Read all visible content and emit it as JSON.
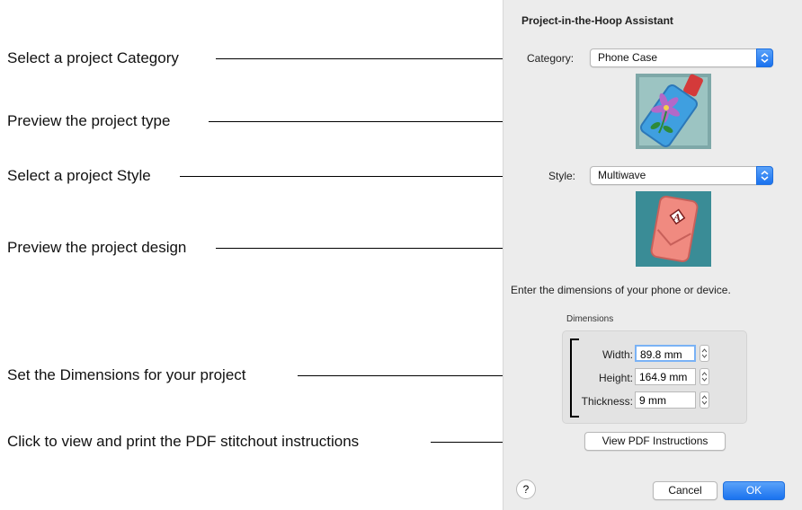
{
  "callouts": [
    "Select a project Category",
    "Preview the project type",
    "Select a project Style",
    "Preview the project design",
    "Set the Dimensions for your project",
    "Click to view and print the PDF stitchout instructions"
  ],
  "dialog": {
    "title": "Project-in-the-Hoop Assistant",
    "category_label": "Category:",
    "category_value": "Phone Case",
    "style_label": "Style:",
    "style_value": "Multiwave",
    "instruction": "Enter the dimensions of your phone or device.",
    "dimensions": {
      "group_label": "Dimensions",
      "width_label": "Width:",
      "width_value": "89.8 mm",
      "height_label": "Height:",
      "height_value": "164.9 mm",
      "thickness_label": "Thickness:",
      "thickness_value": "9 mm"
    },
    "view_pdf_button": "View PDF Instructions",
    "help_button": "?",
    "cancel_button": "Cancel",
    "ok_button": "OK"
  },
  "colors": {
    "accent": "#1a72ef",
    "panel": "#ececec",
    "teal_bg": "#3a8c96",
    "case_pink": "#f08a80"
  },
  "icons": {
    "preview_type": "phone-case-image",
    "preview_design": "multiwave-design-image"
  }
}
